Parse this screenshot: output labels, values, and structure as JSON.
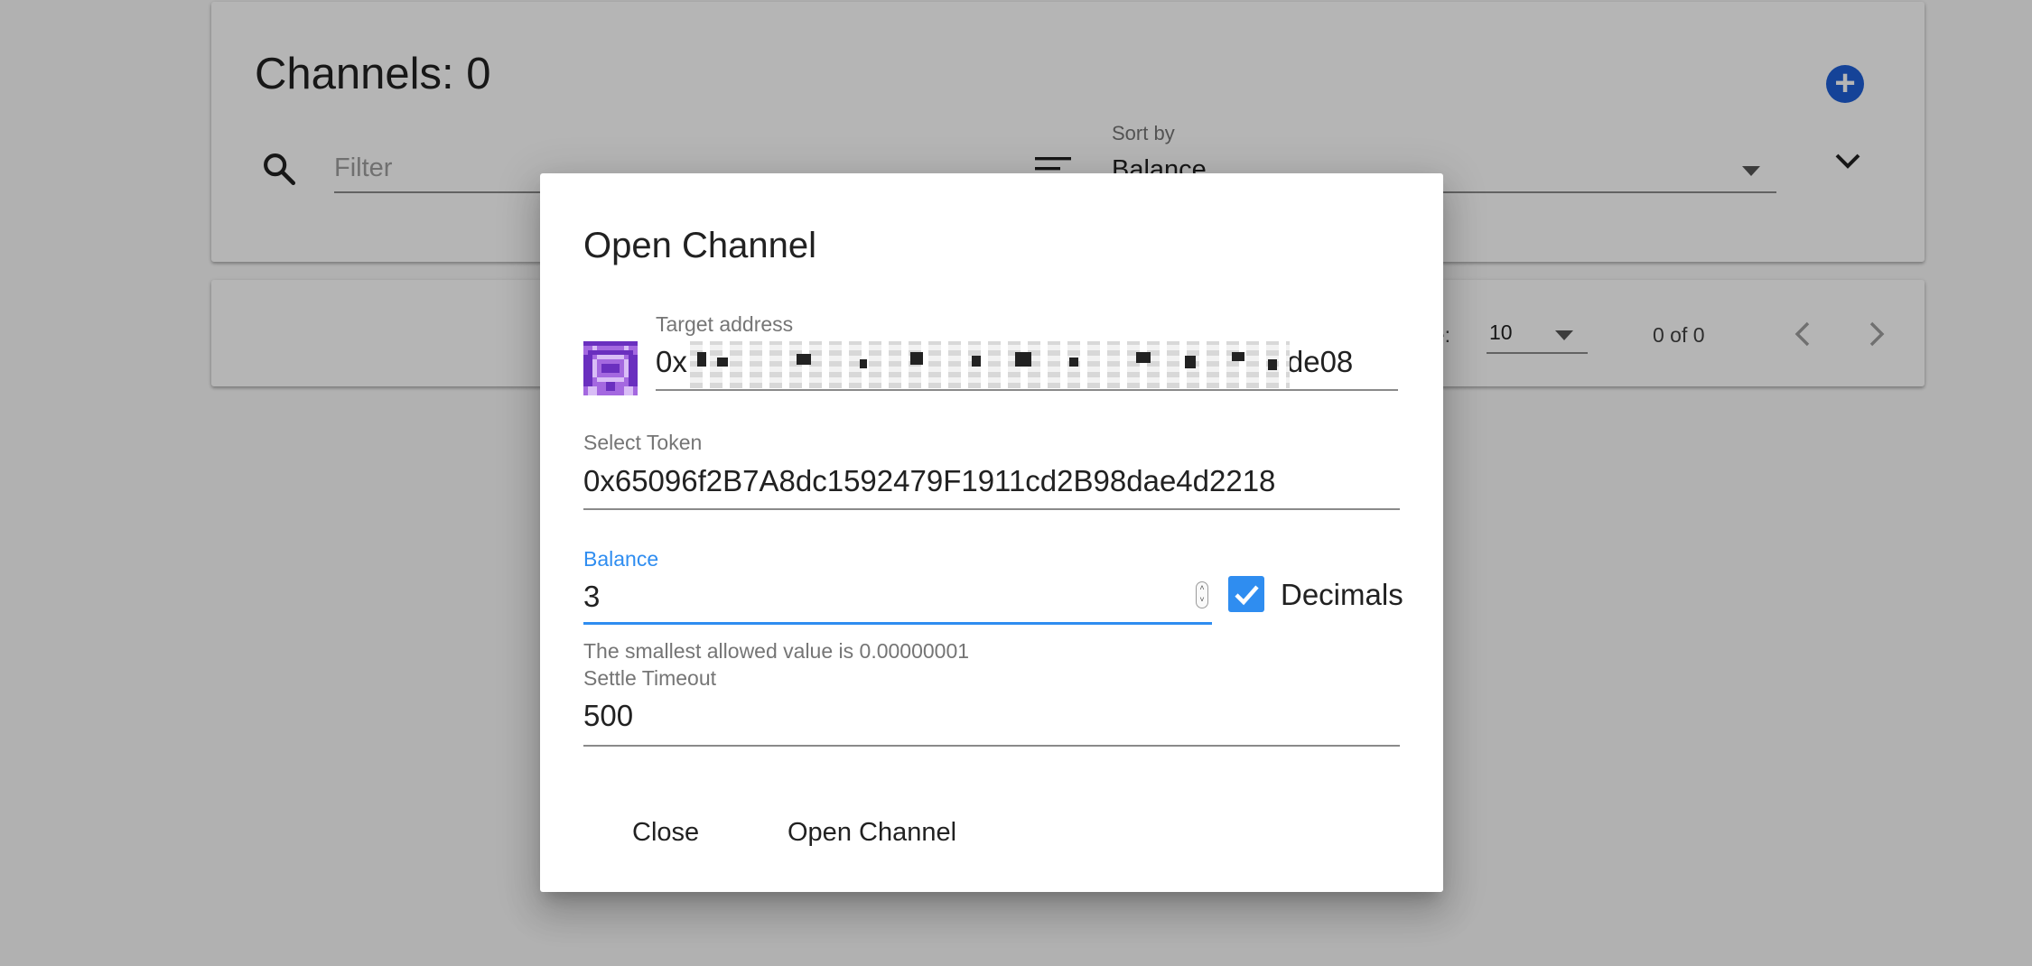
{
  "page": {
    "title_prefix": "Channels: ",
    "channel_count": "0",
    "title": "Channels: 0",
    "add_button_glyph": "+",
    "filter_placeholder": "Filter",
    "sort_label": "Sort by",
    "sort_value": "Balance",
    "per_page_label": "ge:",
    "per_page_value": "10",
    "page_range": "0 of 0",
    "icons": [
      "search-icon",
      "sort-icon",
      "chevron-down-icon",
      "add-icon",
      "chevron-left-icon",
      "chevron-right-icon"
    ]
  },
  "dialog": {
    "title": "Open Channel",
    "target_address": {
      "label": "Target address",
      "value_prefix": "0x",
      "value_suffix": "de08"
    },
    "token": {
      "label": "Select Token",
      "value": "0x65096f2B7A8dc1592479F1911cd2B98dae4d2218"
    },
    "balance": {
      "label": "Balance",
      "value": "3",
      "hint": "The smallest allowed value is 0.00000001"
    },
    "decimals": {
      "label": "Decimals",
      "checked": true
    },
    "settle_timeout": {
      "label": "Settle Timeout",
      "value": "500"
    },
    "buttons": {
      "close": "Close",
      "open": "Open Channel"
    }
  },
  "colors": {
    "accent": "#2f8df0",
    "fab": "#1e5fd6",
    "identicon_primary": "#a468e0",
    "identicon_dark": "#6a2fbf",
    "identicon_light": "#d9bdf6"
  }
}
